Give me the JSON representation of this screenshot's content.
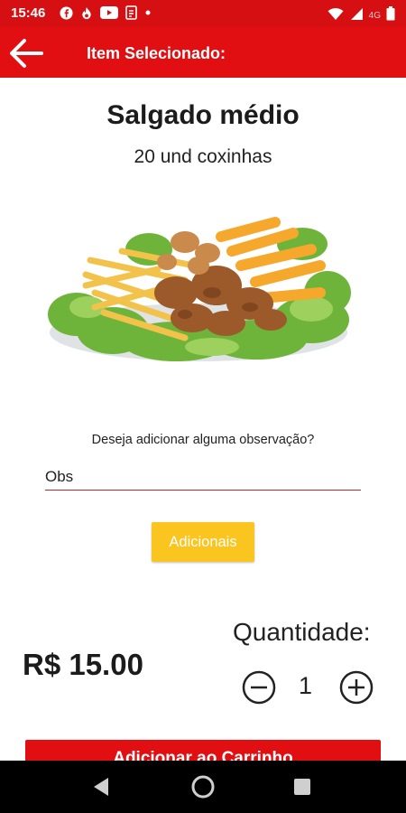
{
  "status_bar": {
    "time": "15:46",
    "network": "4G",
    "icons": [
      "facebook-icon",
      "fire-icon",
      "youtube-icon",
      "document-icon",
      "dot-icon",
      "wifi-icon",
      "signal-icon",
      "battery-icon"
    ]
  },
  "header": {
    "title": "Item Selecionado:",
    "back_icon": "arrow-left-icon",
    "color": "#e10f12"
  },
  "item": {
    "name": "Salgado médio",
    "description": "20 und coxinhas",
    "price": "R$ 15.00"
  },
  "observation": {
    "question": "Deseja adicionar alguma observação?",
    "placeholder": "Obs",
    "value": ""
  },
  "addons": {
    "label": "Adicionais",
    "color": "#f9c51e"
  },
  "quantity": {
    "label": "Quantidade:",
    "value": "1",
    "minus_icon": "minus-circle-icon",
    "plus_icon": "plus-circle-icon"
  },
  "cart": {
    "add_label": "Adicionar ao Carrinho"
  },
  "nav": {
    "icons": [
      "nav-back-icon",
      "nav-home-icon",
      "nav-recents-icon"
    ]
  }
}
